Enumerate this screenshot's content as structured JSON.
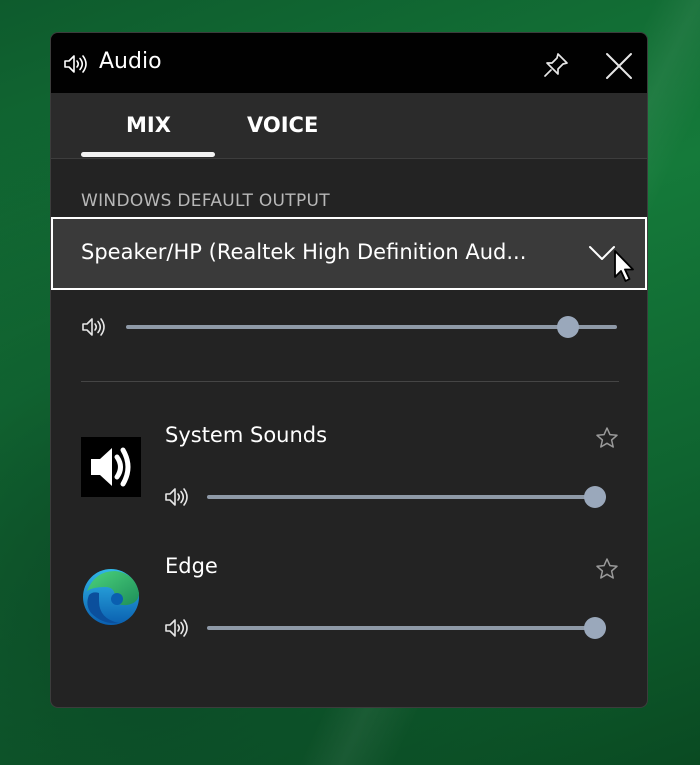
{
  "window": {
    "title": "Audio",
    "title_icon": "speaker-icon",
    "pin_icon": "pin-icon",
    "close_icon": "close-icon"
  },
  "tabs": [
    {
      "label": "MIX",
      "selected": true
    },
    {
      "label": "VOICE",
      "selected": false
    }
  ],
  "output": {
    "section_label": "WINDOWS DEFAULT OUTPUT",
    "device": "Speaker/HP (Realtek High Definition Aud...",
    "volume": 0.92
  },
  "apps": [
    {
      "name": "System Sounds",
      "icon": "speaker-app-icon",
      "favorite_icon": "star-icon",
      "volume": 1.0
    },
    {
      "name": "Edge",
      "icon": "edge-icon",
      "favorite_icon": "star-icon",
      "volume": 1.0
    }
  ],
  "colors": {
    "panel_bg": "#232323",
    "titlebar_bg": "#010101",
    "slider_track": "#8e99a7",
    "slider_thumb": "#9aa8bb",
    "desktop_green": "#157a3a"
  }
}
